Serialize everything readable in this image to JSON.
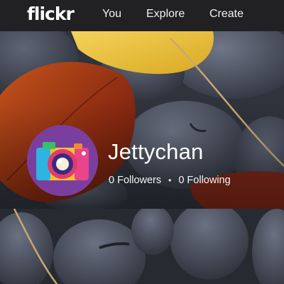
{
  "nav": {
    "logo": "flickr",
    "you": "You",
    "explore": "Explore",
    "create": "Create"
  },
  "profile": {
    "username": "Jettychan",
    "followers": "0 Followers",
    "separator": "•",
    "following": "0 Following"
  },
  "colors": {
    "nav_bg": "#212124",
    "avatar_bg": "#7a3f9e",
    "text": "#ffffff"
  },
  "icons": {
    "avatar": "camera-icon"
  }
}
